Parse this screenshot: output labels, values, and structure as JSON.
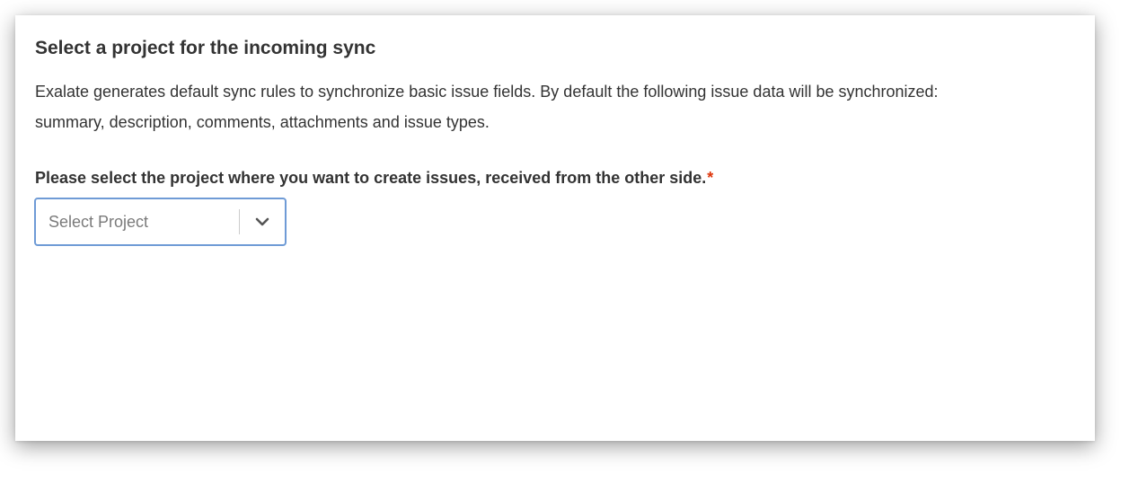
{
  "panel": {
    "title": "Select a project for the incoming sync",
    "description_line1": "Exalate generates default sync rules to synchronize basic issue fields. By default the following issue data will be synchronized:",
    "description_line2": "summary, description, comments, attachments and issue types.",
    "field_label": "Please select the project where you want to create issues, received from the other side.",
    "required_marker": "*",
    "project_select": {
      "placeholder": "Select Project",
      "icon": "chevron-down-icon"
    }
  },
  "colors": {
    "text": "#333333",
    "required": "#de350b",
    "select_border_focus": "#6f9bd6",
    "placeholder": "#7a7a7a"
  }
}
